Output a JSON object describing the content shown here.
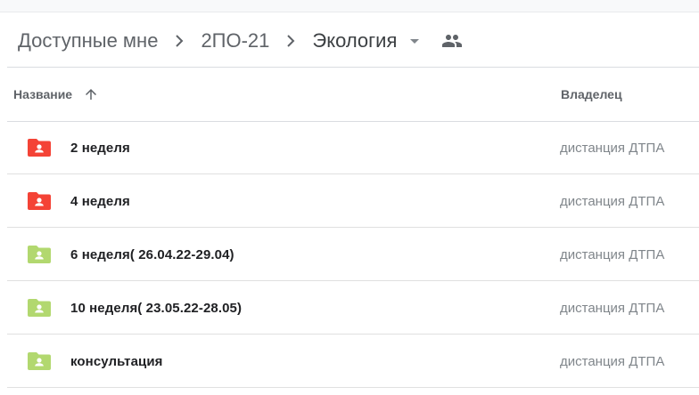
{
  "breadcrumb": {
    "root": "Доступные мне",
    "parent": "2ПО-21",
    "current": "Экология"
  },
  "table": {
    "col_name": "Название",
    "col_owner": "Владелец",
    "rows": [
      {
        "name": "2 неделя",
        "owner": "дистанция ДТПА",
        "color": "#f44336"
      },
      {
        "name": "4 неделя",
        "owner": "дистанция ДТПА",
        "color": "#f44336"
      },
      {
        "name": "6 неделя( 26.04.22-29.04)",
        "owner": "дистанция ДТПА",
        "color": "#b2d86f"
      },
      {
        "name": "10 неделя( 23.05.22-28.05)",
        "owner": "дистанция ДТПА",
        "color": "#b2d86f"
      },
      {
        "name": "консультация",
        "owner": "дистанция ДТПА",
        "color": "#b2d86f"
      }
    ]
  },
  "icons": [
    "chevron-right-icon",
    "dropdown-arrow-icon",
    "shared-people-icon",
    "sort-up-arrow-icon",
    "shared-folder-icon"
  ]
}
